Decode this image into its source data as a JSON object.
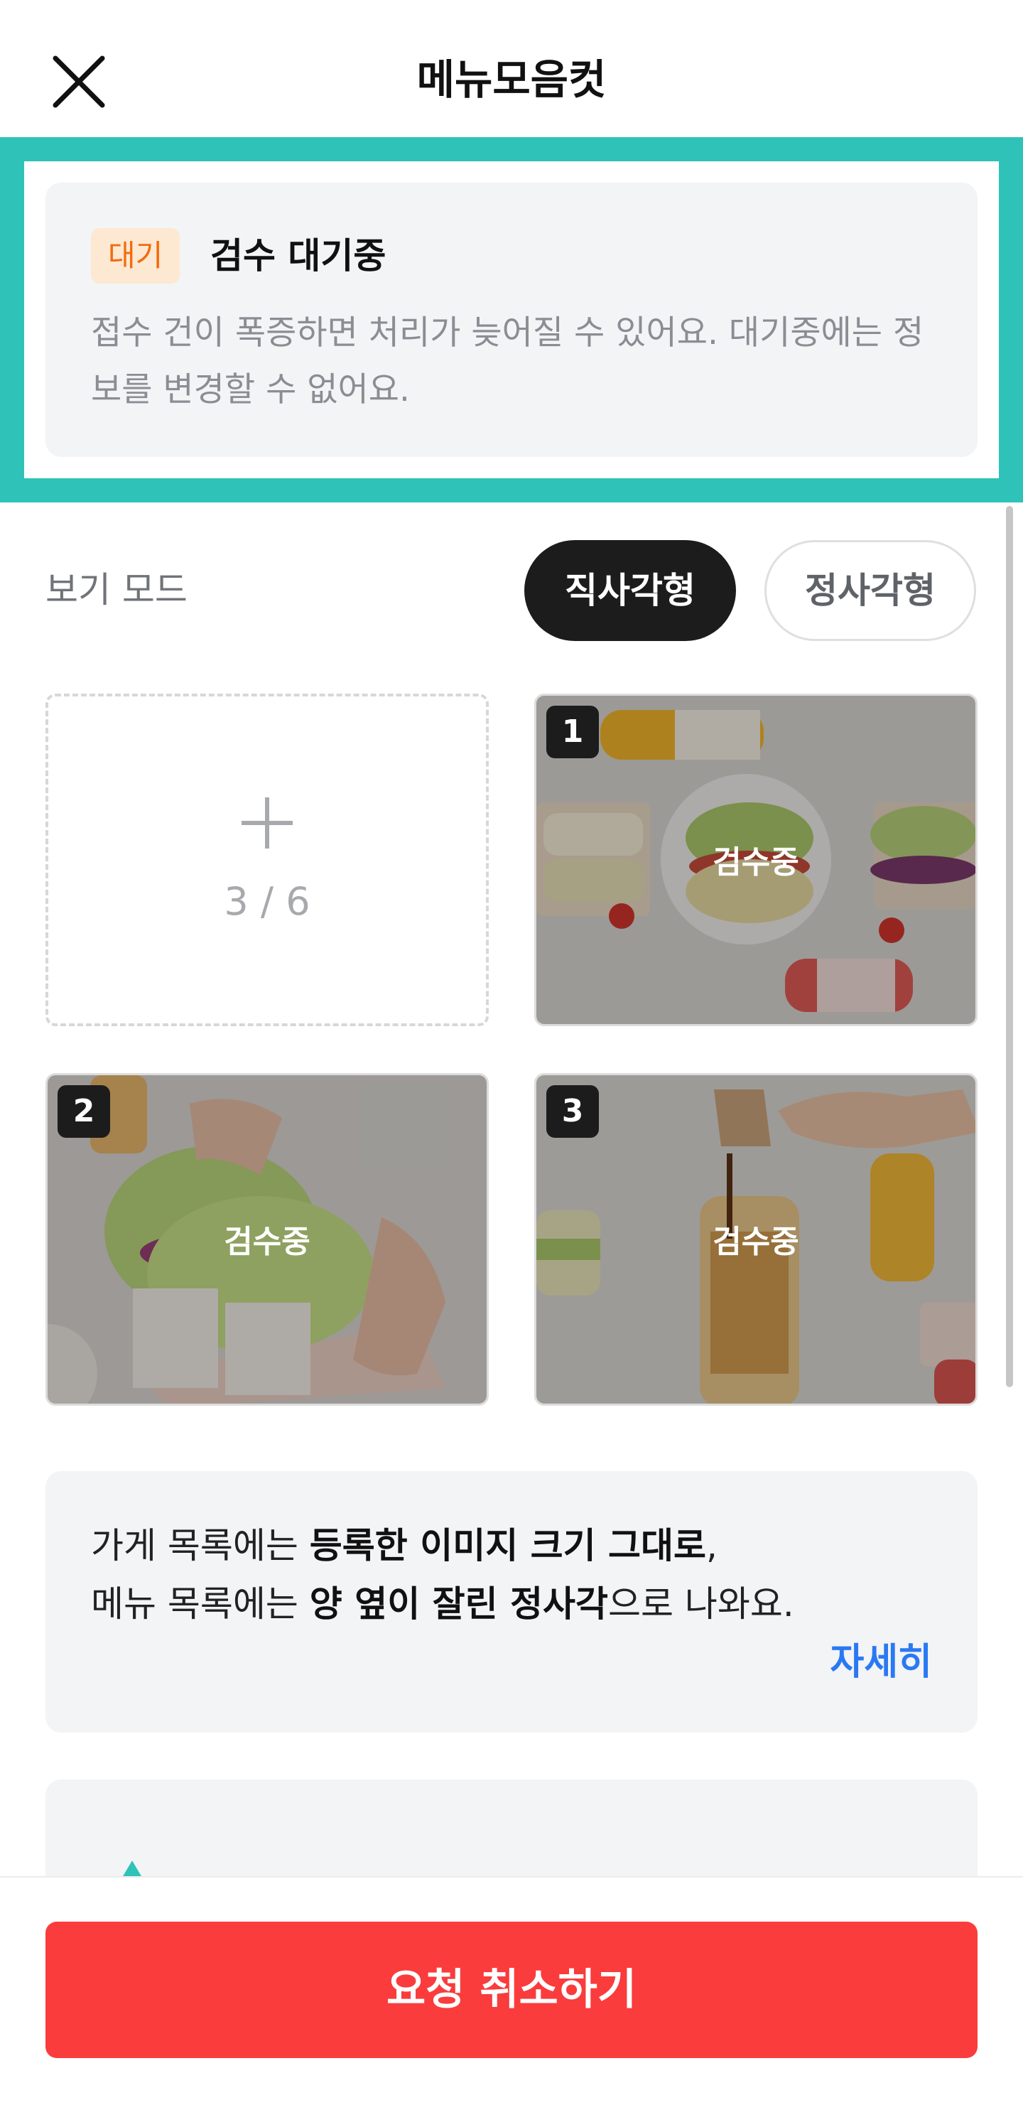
{
  "header": {
    "title": "메뉴모음컷",
    "close_icon": "close-icon"
  },
  "notice": {
    "badge": "대기",
    "heading": "검수 대기중",
    "description": "접수 건이 폭증하면 처리가 늦어질 수 있어요. 대기중에는 정보를 변경할 수 없어요.",
    "frame_color": "#2fc2b8",
    "badge_color": "#f26b0f"
  },
  "view_mode": {
    "label": "보기 모드",
    "options": [
      "직사각형",
      "정사각형"
    ],
    "selected": "직사각형"
  },
  "gallery": {
    "add_icon": "plus-icon",
    "count": "3 / 6",
    "photos": [
      {
        "number": "1",
        "status": "검수중",
        "subject": "sandwiches with juice bottles"
      },
      {
        "number": "2",
        "status": "검수중",
        "subject": "hands holding sandwich"
      },
      {
        "number": "3",
        "status": "검수중",
        "subject": "pouring syrup into drink bottle"
      }
    ]
  },
  "info": {
    "line1_prefix": "가게 목록에는 ",
    "line1_bold": "등록한 이미지 크기 그대로",
    "line1_suffix": ",",
    "line2_prefix": "메뉴 목록에는 ",
    "line2_bold": "양 옆이 잘린 정사각",
    "line2_suffix": "으로 나와요.",
    "more_link": "자세히",
    "link_color": "#2a79f3"
  },
  "footer": {
    "cancel_button": "요청 취소하기",
    "button_color": "#fa3c3c"
  }
}
